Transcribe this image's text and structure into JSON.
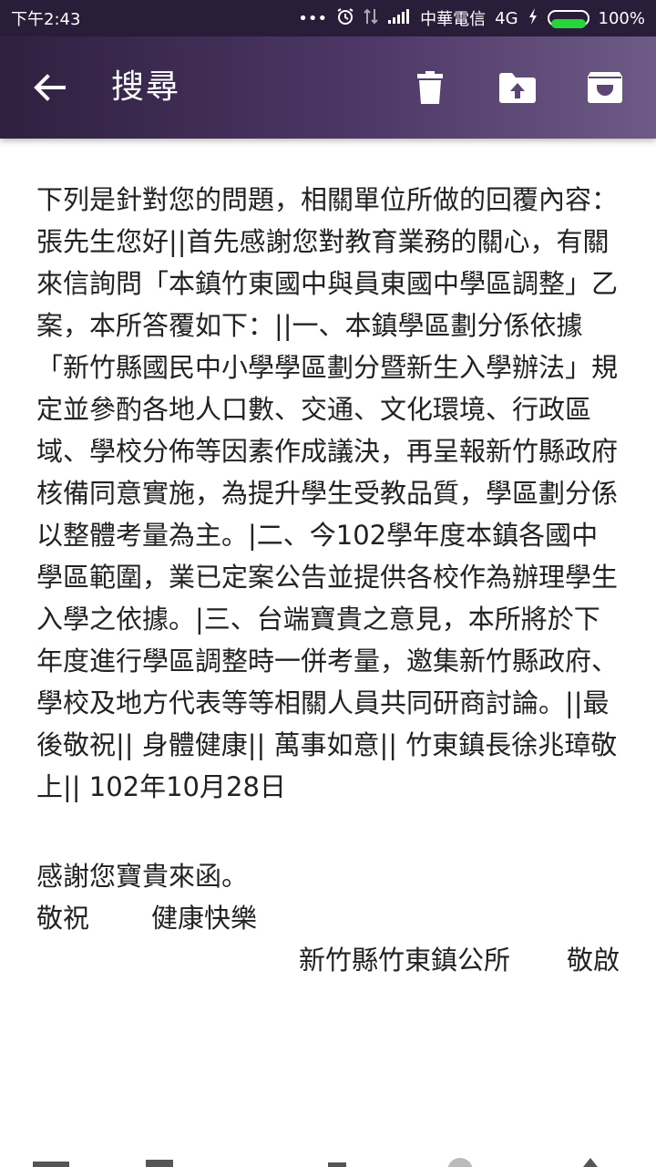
{
  "status_bar": {
    "time": "下午2:43",
    "dots": "•••",
    "carrier": "中華電信",
    "network": "4G",
    "battery_text": "100%",
    "battery_level": 1.0
  },
  "app_bar": {
    "title": "搜尋",
    "icons": {
      "back": "arrow-back-icon",
      "delete": "trash-icon",
      "move": "folder-upload-icon",
      "archive": "archive-icon"
    }
  },
  "message": {
    "intro": "下列是針對您的問題，相關單位所做的回覆內容：",
    "body": "張先生您好||首先感謝您對教育業務的關心，有關來信詢問「本鎮竹東國中與員東國中學區調整」乙案，本所答覆如下：||一、本鎮學區劃分係依據「新竹縣國民中小學學區劃分暨新生入學辦法」規定並參酌各地人口數、交通、文化環境、行政區域、學校分佈等因素作成議決，再呈報新竹縣政府核備同意實施，為提升學生受教品質，學區劃分係以整體考量為主。|二、今102學年度本鎮各國中學區範圍，業已定案公告並提供各校作為辦理學生入學之依據。|三、台端寶貴之意見，本所將於下年度進行學區調整時一併考量，邀集新竹縣政府、學校及地方代表等等相關人員共同研商討論。||最後敬祝|| 身體健康|| 萬事如意|| 竹東鎮長徐兆璋敬上|| 102年10月28日",
    "thanks": "感謝您寶貴來函。",
    "regards_lead": "敬祝",
    "regards_wish": "健康快樂",
    "sender": "新竹縣竹東鎮公所",
    "closing": "敬啟"
  }
}
